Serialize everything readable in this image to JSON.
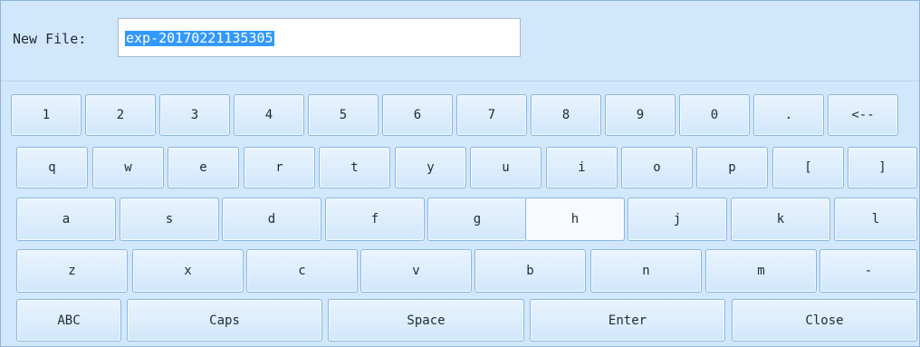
{
  "file": {
    "label": "New File:",
    "value": "exp-20170221135305"
  },
  "keyboard": {
    "row1": [
      "1",
      "2",
      "3",
      "4",
      "5",
      "6",
      "7",
      "8",
      "9",
      "0",
      ".",
      "<--"
    ],
    "row2": [
      "q",
      "w",
      "e",
      "r",
      "t",
      "y",
      "u",
      "i",
      "o",
      "p",
      "[",
      "]"
    ],
    "row3": [
      "a",
      "s",
      "d",
      "f",
      "g",
      "h",
      "j",
      "k",
      "l"
    ],
    "row4": [
      "z",
      "x",
      "c",
      "v",
      "b",
      "n",
      "m",
      "-"
    ],
    "row5": [
      "ABC",
      "Caps",
      "Space",
      "Enter",
      "Close"
    ]
  }
}
